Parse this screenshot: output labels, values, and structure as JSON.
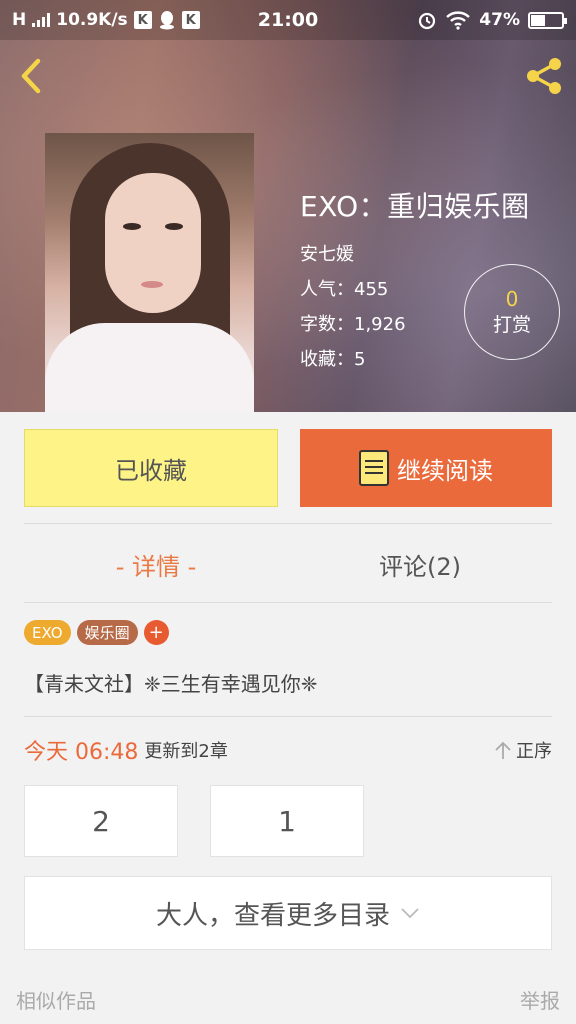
{
  "status_bar": {
    "network": "H",
    "speed": "10.9K/s",
    "time": "21:00",
    "battery": "47%",
    "battery_level": 0.47
  },
  "book": {
    "title": "EXO：重归娱乐圈",
    "author": "安七媛",
    "popularity": "人气：455",
    "word_count": "字数：1,926",
    "favorites": "收藏：5"
  },
  "tip": {
    "count": "0",
    "label": "打赏"
  },
  "actions": {
    "favorited_label": "已收藏",
    "continue_label": "继续阅读"
  },
  "tabs": [
    {
      "label": "- 详情 -",
      "active": true
    },
    {
      "label": "评论(2)",
      "active": false
    }
  ],
  "tags": [
    {
      "label": "EXO",
      "color": "#eea92f"
    },
    {
      "label": "娱乐圈",
      "color": "#b76a48"
    }
  ],
  "tag_add": "+",
  "description": "【青未文社】❈三生有幸遇见你❈",
  "update": {
    "date": "今天 06:48",
    "text": "更新到2章",
    "sort_label": "正序"
  },
  "chapters": [
    "2",
    "1"
  ],
  "more_catalog": "大人，查看更多目录",
  "footer": {
    "similar": "相似作品",
    "report": "举报"
  },
  "colors": {
    "accent_orange": "#ea6a3b",
    "fav_yellow": "#fdf386",
    "icon_yellow": "#f5d44a"
  }
}
